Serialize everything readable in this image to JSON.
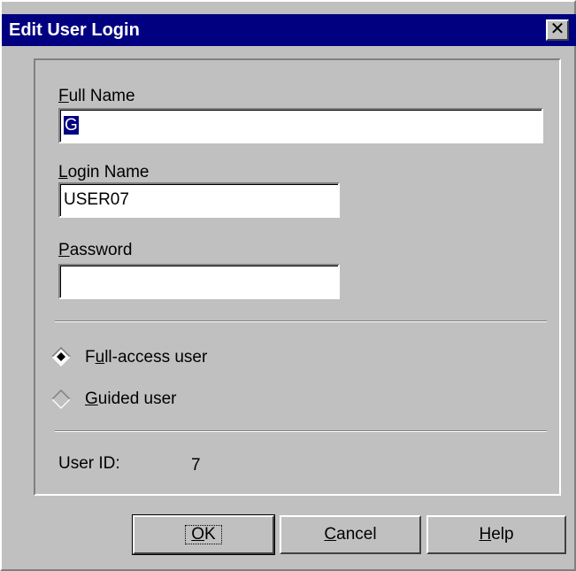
{
  "window": {
    "title": "Edit User Login",
    "close_glyph": "✕"
  },
  "fields": {
    "full_name": {
      "label_access": "F",
      "label_rest": "ull Name",
      "value": "G"
    },
    "login_name": {
      "label_access": "L",
      "label_rest": "ogin Name",
      "value": "USER07"
    },
    "password": {
      "label_access": "P",
      "label_rest": "assword",
      "value": ""
    }
  },
  "access": {
    "options": [
      {
        "pre": "F",
        "access": "u",
        "post": "ll-access user",
        "selected": true
      },
      {
        "pre": "",
        "access": "G",
        "post": "uided user",
        "selected": false
      }
    ]
  },
  "user_id": {
    "label": "User ID:",
    "value": "7"
  },
  "buttons": {
    "ok": {
      "access": "O",
      "rest": "K"
    },
    "cancel": {
      "access": "C",
      "rest": "ancel"
    },
    "help": {
      "access": "H",
      "rest": "elp"
    }
  },
  "colors": {
    "titlebar": "#000080",
    "face": "#c0c0c0",
    "selection": "#000080"
  }
}
